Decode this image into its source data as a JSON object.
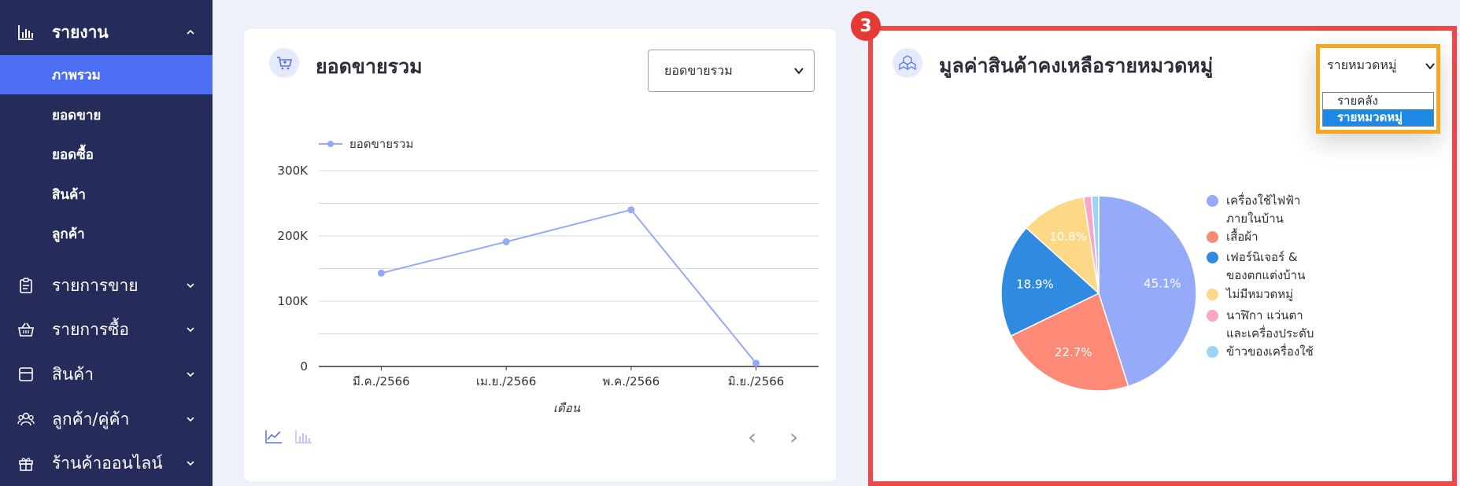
{
  "sidebar": {
    "report": {
      "label": "รายงาน"
    },
    "submenu": [
      {
        "label": "ภาพรวม",
        "active": true
      },
      {
        "label": "ยอดขาย",
        "active": false
      },
      {
        "label": "ยอดซื้อ",
        "active": false
      },
      {
        "label": "สินค้า",
        "active": false
      },
      {
        "label": "ลูกค้า",
        "active": false
      }
    ],
    "sections": [
      {
        "label": "รายการขาย",
        "icon": "clipboard-icon"
      },
      {
        "label": "รายการซื้อ",
        "icon": "basket-icon"
      },
      {
        "label": "สินค้า",
        "icon": "box-icon"
      },
      {
        "label": "ลูกค้า/คู่ค้า",
        "icon": "users-icon"
      },
      {
        "label": "ร้านค้าออนไลน์",
        "icon": "gift-icon"
      }
    ]
  },
  "sales_card": {
    "title": "ยอดขายรวม",
    "select_value": "ยอดขายรวม",
    "icon": "cart-icon"
  },
  "inventory_card": {
    "title": "มูลค่าสินค้าคงเหลือรายหมวดหมู่",
    "select_value": "รายหมวดหมู่",
    "dropdown_options": [
      "รายคลัง",
      "รายหมวดหมู่"
    ],
    "selected_option": "รายหมวดหมู่",
    "icon": "boxes-icon",
    "badge": "3"
  },
  "colors": {
    "sidebar_bg": "#252c5a",
    "active_item": "#4b6ef3",
    "highlight_red": "#f04848",
    "highlight_orange": "#f5a623"
  },
  "chart_data": [
    {
      "type": "line",
      "legend": [
        "ยอดขายรวม"
      ],
      "categories": [
        "มี.ค./2566",
        "เม.ย./2566",
        "พ.ค./2566",
        "มิ.ย./2566"
      ],
      "series": [
        {
          "name": "ยอดขายรวม",
          "values": [
            143000,
            191000,
            240000,
            5000
          ],
          "color": "#94a9f7"
        }
      ],
      "y_ticks": [
        "0",
        "100K",
        "200K",
        "300K"
      ],
      "ylim": [
        0,
        300000
      ],
      "xlabel": "เดือน",
      "ylabel": "",
      "grid": true,
      "legend_position": "top-left"
    },
    {
      "type": "pie",
      "slices": [
        {
          "label": "เครื่องใช้ไฟฟ้า ภายในบ้าน",
          "lines": [
            "เครื่องใช้ไฟฟ้า",
            "ภายในบ้าน"
          ],
          "value": 45.1,
          "text": "45.1%",
          "color": "#96aafa"
        },
        {
          "label": "เสื้อผ้า",
          "lines": [
            "เสื้อผ้า"
          ],
          "value": 22.7,
          "text": "22.7%",
          "color": "#fc8a76"
        },
        {
          "label": "เฟอร์นิเจอร์ & ของตกแต่งบ้าน",
          "lines": [
            "เฟอร์นิเจอร์ &",
            "ของตกแต่งบ้าน"
          ],
          "value": 18.9,
          "text": "18.9%",
          "color": "#2f8ae0"
        },
        {
          "label": "ไม่มีหมวดหมู่",
          "lines": [
            "ไม่มีหมวดหมู่"
          ],
          "value": 10.8,
          "text": "10.8%",
          "color": "#fdd886"
        },
        {
          "label": "นาฬิกา แว่นตา และเครื่องประดับ",
          "lines": [
            "นาฬิกา แว่นตา",
            "และเครื่องประดับ"
          ],
          "value": 1.3,
          "text": "",
          "color": "#f9a5c5"
        },
        {
          "label": "ข้าวของเครื่องใช้",
          "lines": [
            "ข้าวของเครื่องใช้"
          ],
          "value": 1.2,
          "text": "",
          "color": "#9ed4f7"
        }
      ],
      "legend_position": "right"
    }
  ],
  "pager": {
    "prev": "‹",
    "next": "›"
  }
}
